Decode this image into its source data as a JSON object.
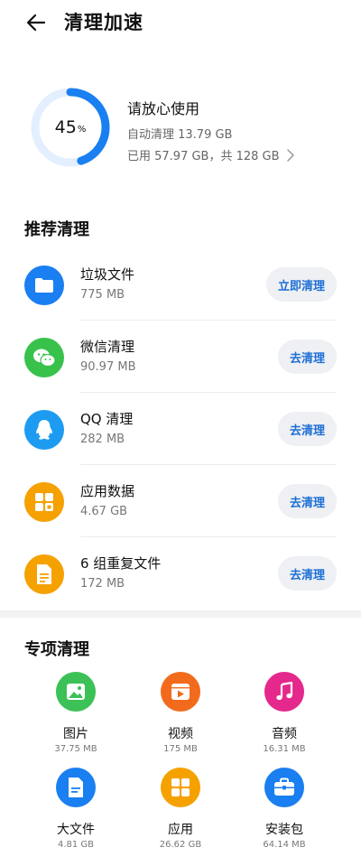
{
  "header": {
    "title": "清理加速"
  },
  "storage": {
    "percent": "45",
    "percent_unit": "%",
    "percent_used": 0.45,
    "status": "请放心使用",
    "auto_clean": "自动清理 13.79 GB",
    "usage": "已用 57.97 GB，共 128 GB"
  },
  "recommended": {
    "title": "推荐清理",
    "items": [
      {
        "name": "垃圾文件",
        "size": "775 MB",
        "button": "立即清理",
        "icon": "folder-icon",
        "color": "#1a7ff0"
      },
      {
        "name": "微信清理",
        "size": "90.97 MB",
        "button": "去清理",
        "icon": "wechat-icon",
        "color": "#38c24b"
      },
      {
        "name": "QQ 清理",
        "size": "282 MB",
        "button": "去清理",
        "icon": "qq-penguin-icon",
        "color": "#1d9bf0"
      },
      {
        "name": "应用数据",
        "size": "4.67 GB",
        "button": "去清理",
        "icon": "app-grid-icon",
        "color": "#f5a100"
      },
      {
        "name": "6 组重复文件",
        "size": "172 MB",
        "button": "去清理",
        "icon": "duplicate-file-icon",
        "color": "#f5a100"
      }
    ]
  },
  "special": {
    "title": "专项清理",
    "items": [
      {
        "name": "图片",
        "size": "37.75 MB",
        "icon": "image-icon",
        "color": "#3cc157"
      },
      {
        "name": "视频",
        "size": "175 MB",
        "icon": "video-icon",
        "color": "#f26b1d"
      },
      {
        "name": "音频",
        "size": "16.31 MB",
        "icon": "music-note-icon",
        "color": "#e5288b"
      },
      {
        "name": "大文件",
        "size": "4.81 GB",
        "icon": "document-icon",
        "color": "#1a7ff0"
      },
      {
        "name": "应用",
        "size": "26.62 GB",
        "icon": "app-grid-icon",
        "color": "#f5a100"
      },
      {
        "name": "安装包",
        "size": "64.14 MB",
        "icon": "briefcase-icon",
        "color": "#1a7ff0"
      }
    ]
  }
}
